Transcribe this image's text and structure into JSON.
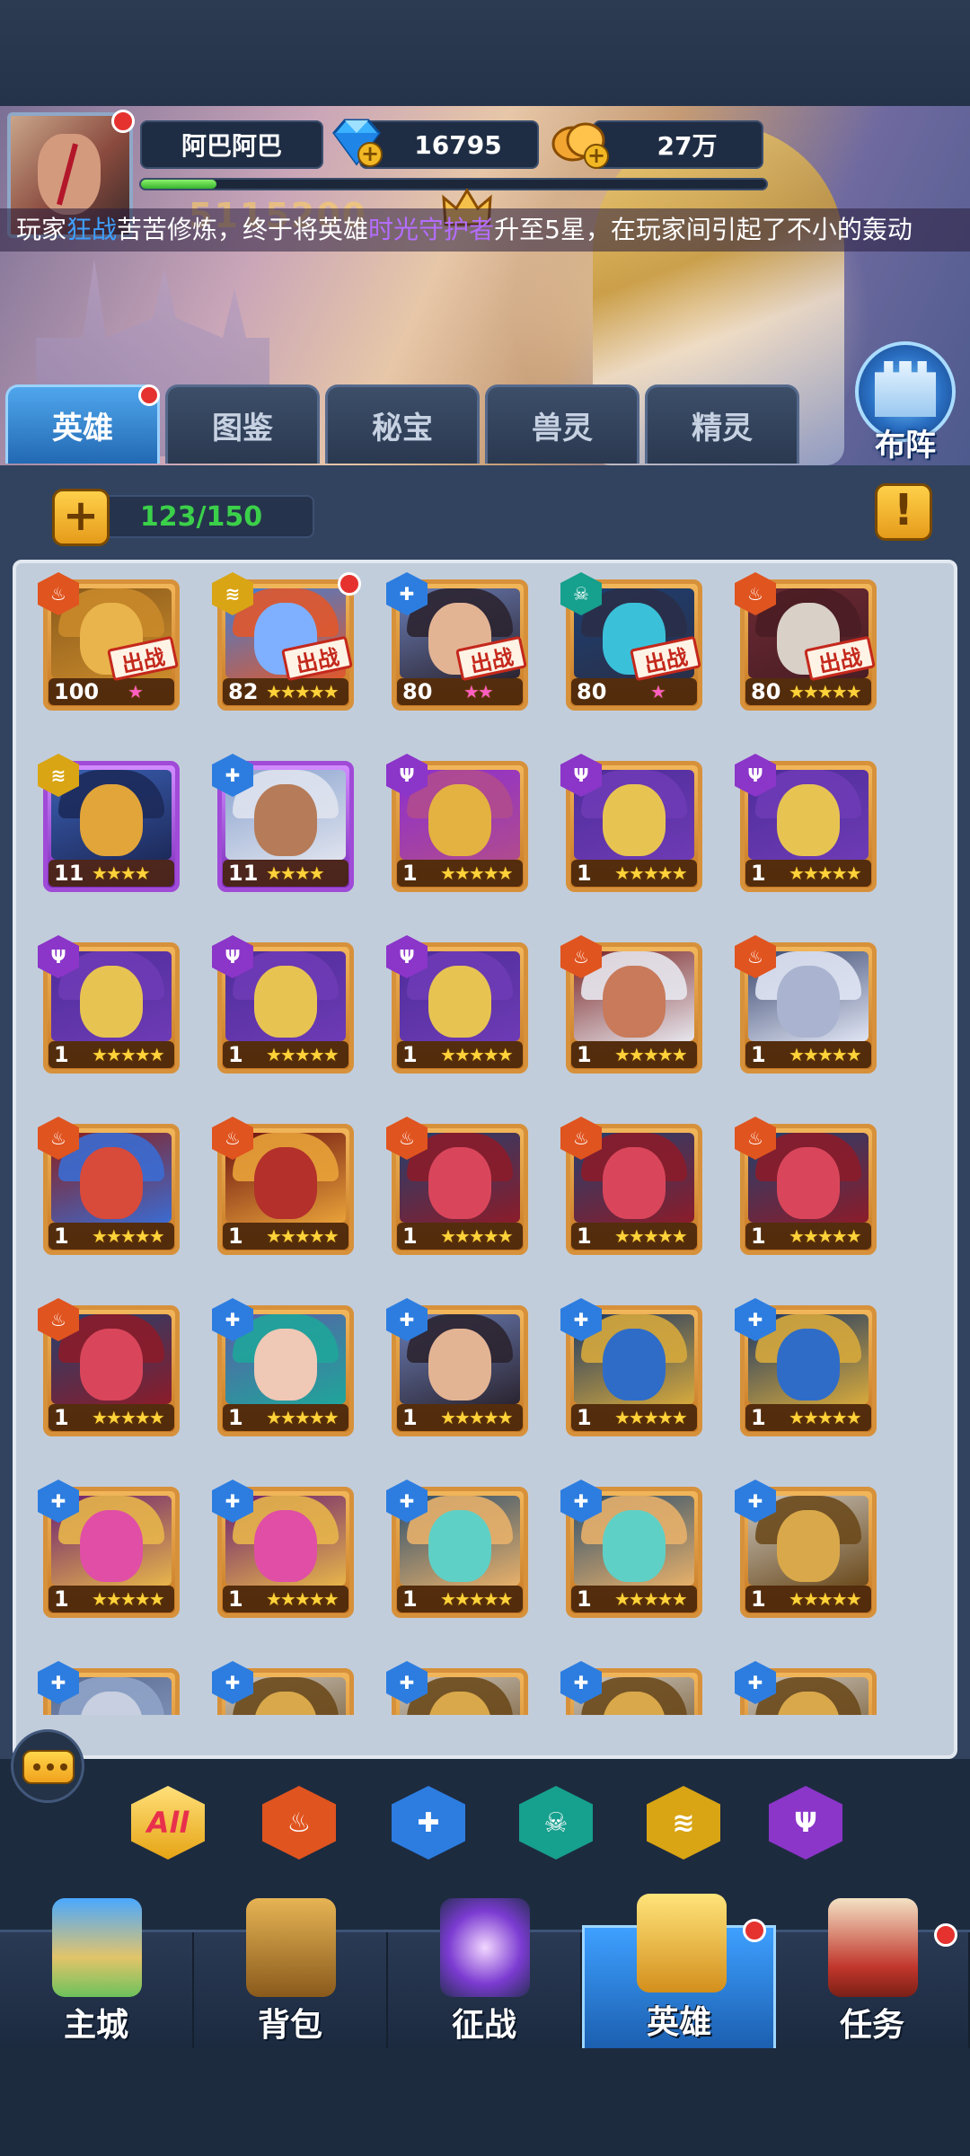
{
  "player": {
    "name": "阿巴阿巴",
    "diamonds": "16795",
    "gold": "27万",
    "power": "5115200",
    "xp_fraction": 0.12
  },
  "marquee": {
    "prefix": "玩家",
    "player": "狂战",
    "middle": "苦苦修炼，终于将英雄",
    "hero": "时光守护者",
    "suffix": "升至5星，在玩家间引起了不小的轰动"
  },
  "deploy_label": "布阵",
  "tabs": [
    {
      "label": "英雄",
      "active": true,
      "has_dot": true
    },
    {
      "label": "图鉴"
    },
    {
      "label": "秘宝"
    },
    {
      "label": "兽灵"
    },
    {
      "label": "精灵"
    }
  ],
  "hero_count": "123/150",
  "info_icon": "exclamation-icon",
  "deploy_tag": "出战",
  "heroes": [
    {
      "level": "100",
      "element": "fire",
      "stars": 1,
      "star_color": "pink",
      "deployed": true,
      "portrait": "golden-knight"
    },
    {
      "level": "82",
      "element": "wind",
      "stars": 5,
      "star_color": "gold",
      "deployed": true,
      "has_dot": true,
      "portrait": "blue-troll"
    },
    {
      "level": "80",
      "element": "holy",
      "stars": 2,
      "star_color": "pink",
      "deployed": true,
      "portrait": "dark-haired-man"
    },
    {
      "level": "80",
      "element": "skull",
      "stars": 1,
      "star_color": "pink",
      "deployed": true,
      "portrait": "dark-knight"
    },
    {
      "level": "80",
      "element": "fire",
      "stars": 5,
      "star_color": "gold",
      "deployed": true,
      "portrait": "skull-pirate"
    },
    {
      "level": "11",
      "element": "wind",
      "stars": 4,
      "star_color": "gold",
      "frame": "purple",
      "portrait": "gold-armor"
    },
    {
      "level": "11",
      "element": "holy",
      "stars": 4,
      "star_color": "gold",
      "frame": "purple",
      "portrait": "dwarf"
    },
    {
      "level": "1",
      "element": "dark",
      "stars": 5,
      "star_color": "gold",
      "portrait": "masked-woman"
    },
    {
      "level": "1",
      "element": "dark",
      "stars": 5,
      "star_color": "gold",
      "portrait": "masked-rogue"
    },
    {
      "level": "1",
      "element": "dark",
      "stars": 5,
      "star_color": "gold",
      "portrait": "masked-rogue"
    },
    {
      "level": "1",
      "element": "dark",
      "stars": 5,
      "star_color": "gold",
      "portrait": "masked-rogue"
    },
    {
      "level": "1",
      "element": "dark",
      "stars": 5,
      "star_color": "gold",
      "portrait": "masked-rogue"
    },
    {
      "level": "1",
      "element": "dark",
      "stars": 5,
      "star_color": "gold",
      "portrait": "masked-rogue"
    },
    {
      "level": "1",
      "element": "fire",
      "stars": 5,
      "star_color": "gold",
      "portrait": "white-haired-man"
    },
    {
      "level": "1",
      "element": "fire",
      "stars": 5,
      "star_color": "gold",
      "portrait": "blade-dancer"
    },
    {
      "level": "1",
      "element": "fire",
      "stars": 5,
      "star_color": "gold",
      "portrait": "red-warrior"
    },
    {
      "level": "1",
      "element": "fire",
      "stars": 5,
      "star_color": "gold",
      "portrait": "demon-lord"
    },
    {
      "level": "1",
      "element": "fire",
      "stars": 5,
      "star_color": "gold",
      "portrait": "red-demon"
    },
    {
      "level": "1",
      "element": "fire",
      "stars": 5,
      "star_color": "gold",
      "portrait": "red-demon"
    },
    {
      "level": "1",
      "element": "fire",
      "stars": 5,
      "star_color": "gold",
      "portrait": "red-demon"
    },
    {
      "level": "1",
      "element": "fire",
      "stars": 5,
      "star_color": "gold",
      "portrait": "red-demon"
    },
    {
      "level": "1",
      "element": "holy",
      "stars": 5,
      "star_color": "gold",
      "portrait": "goggle-girl"
    },
    {
      "level": "1",
      "element": "holy",
      "stars": 5,
      "star_color": "gold",
      "portrait": "dark-haired-man"
    },
    {
      "level": "1",
      "element": "holy",
      "stars": 5,
      "star_color": "gold",
      "portrait": "blue-knight"
    },
    {
      "level": "1",
      "element": "holy",
      "stars": 5,
      "star_color": "gold",
      "portrait": "blue-knight"
    },
    {
      "level": "1",
      "element": "holy",
      "stars": 5,
      "star_color": "gold",
      "portrait": "pink-sorceress"
    },
    {
      "level": "1",
      "element": "holy",
      "stars": 5,
      "star_color": "gold",
      "portrait": "pink-sorceress"
    },
    {
      "level": "1",
      "element": "holy",
      "stars": 5,
      "star_color": "gold",
      "portrait": "goggle-engineer"
    },
    {
      "level": "1",
      "element": "holy",
      "stars": 5,
      "star_color": "gold",
      "portrait": "goggle-engineer"
    },
    {
      "level": "1",
      "element": "holy",
      "stars": 5,
      "star_color": "gold",
      "portrait": "gold-helmet"
    },
    {
      "level": "",
      "element": "holy",
      "stars": 0,
      "partial": true,
      "portrait": "grey-wizard"
    },
    {
      "level": "",
      "element": "holy",
      "stars": 0,
      "partial": true,
      "portrait": "gold-helmet"
    },
    {
      "level": "",
      "element": "holy",
      "stars": 0,
      "partial": true,
      "portrait": "gold-helmet"
    },
    {
      "level": "",
      "element": "holy",
      "stars": 0,
      "partial": true,
      "portrait": "gold-helmet"
    },
    {
      "level": "",
      "element": "holy",
      "stars": 0,
      "partial": true,
      "portrait": "gold-helmet"
    }
  ],
  "filters": [
    {
      "label": "All",
      "icon": "all-filter"
    },
    {
      "icon": "fire-element-icon",
      "color": "#e0541f"
    },
    {
      "icon": "holy-element-icon",
      "color": "#2d7de0"
    },
    {
      "icon": "skull-element-icon",
      "color": "#16a08e"
    },
    {
      "icon": "wind-element-icon",
      "color": "#d9a514"
    },
    {
      "icon": "dark-element-icon",
      "color": "#8b35c9"
    }
  ],
  "nav": [
    {
      "label": "主城",
      "icon": "castle-icon"
    },
    {
      "label": "背包",
      "icon": "chest-icon"
    },
    {
      "label": "征战",
      "icon": "dragon-portal-icon"
    },
    {
      "label": "英雄",
      "icon": "golden-helmet-icon",
      "active": true,
      "has_dot": true
    },
    {
      "label": "任务",
      "icon": "scroll-icon",
      "has_dot": true
    }
  ],
  "colors": {
    "accent": "#3ea0ff",
    "gold": "#ffd23a",
    "counter_green": "#3bd04a",
    "notify_red": "#e5322f"
  }
}
